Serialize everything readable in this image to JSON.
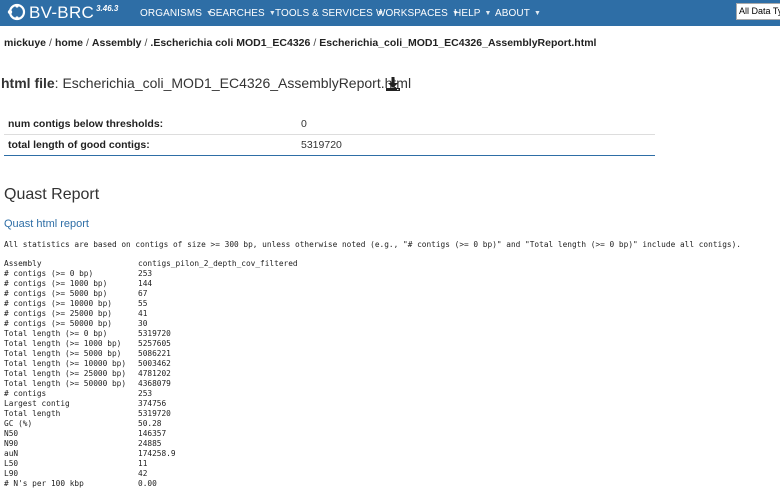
{
  "header": {
    "logo_text": "BV-BRC",
    "version": "3.46.3",
    "nav": [
      {
        "label": "ORGANISMS"
      },
      {
        "label": "SEARCHES"
      },
      {
        "label": "TOOLS & SERVICES"
      },
      {
        "label": "WORKSPACES"
      },
      {
        "label": "HELP"
      },
      {
        "label": "ABOUT"
      }
    ],
    "search_select": "All Data Ty",
    "bar_color": "#2e6ea6"
  },
  "breadcrumb": [
    "mickuye",
    "home",
    "Assembly",
    ".Escherichia coli MOD1_EC4326",
    "Escherichia_coli_MOD1_EC4326_AssemblyReport.html"
  ],
  "file": {
    "label": "html file",
    "name": "Escherichia_coli_MOD1_EC4326_AssemblyReport.html",
    "download_icon": "download-icon"
  },
  "summary": [
    {
      "key": "num contigs below thresholds:",
      "value": "0"
    },
    {
      "key": "total length of good contigs:",
      "value": "5319720"
    }
  ],
  "quast": {
    "title": "Quast Report",
    "link": "Quast html report",
    "note": "All statistics are based on contigs of size >= 300 bp, unless otherwise noted (e.g., \"# contigs (>= 0 bp)\" and \"Total length (>= 0 bp)\" include all contigs).",
    "rows": [
      {
        "label": "Assembly",
        "value": "contigs_pilon_2_depth_cov_filtered"
      },
      {
        "label": "# contigs (>= 0 bp)",
        "value": "253"
      },
      {
        "label": "# contigs (>= 1000 bp)",
        "value": "144"
      },
      {
        "label": "# contigs (>= 5000 bp)",
        "value": "67"
      },
      {
        "label": "# contigs (>= 10000 bp)",
        "value": "55"
      },
      {
        "label": "# contigs (>= 25000 bp)",
        "value": "41"
      },
      {
        "label": "# contigs (>= 50000 bp)",
        "value": "30"
      },
      {
        "label": "Total length (>= 0 bp)",
        "value": "5319720"
      },
      {
        "label": "Total length (>= 1000 bp)",
        "value": "5257605"
      },
      {
        "label": "Total length (>= 5000 bp)",
        "value": "5086221"
      },
      {
        "label": "Total length (>= 10000 bp)",
        "value": "5003462"
      },
      {
        "label": "Total length (>= 25000 bp)",
        "value": "4781202"
      },
      {
        "label": "Total length (>= 50000 bp)",
        "value": "4368079"
      },
      {
        "label": "# contigs",
        "value": "253"
      },
      {
        "label": "Largest contig",
        "value": "374756"
      },
      {
        "label": "Total length",
        "value": "5319720"
      },
      {
        "label": "GC (%)",
        "value": "50.28"
      },
      {
        "label": "N50",
        "value": "146357"
      },
      {
        "label": "N90",
        "value": "24885"
      },
      {
        "label": "auN",
        "value": "174258.9"
      },
      {
        "label": "L50",
        "value": "11"
      },
      {
        "label": "L90",
        "value": "42"
      },
      {
        "label": "# N's per 100 kbp",
        "value": "0.00"
      }
    ]
  }
}
